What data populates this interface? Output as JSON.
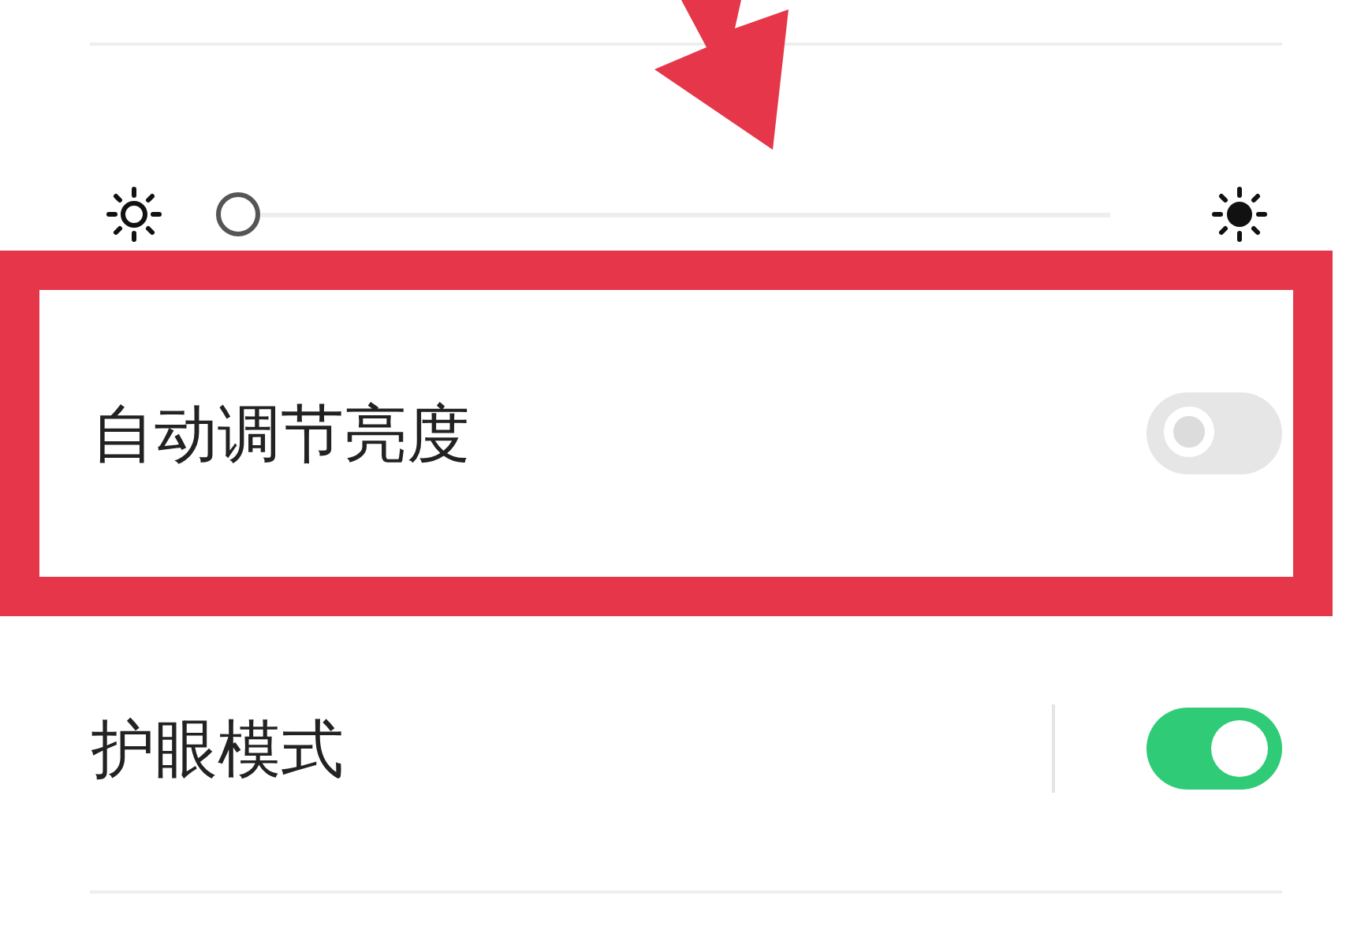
{
  "brightness": {
    "level": 0
  },
  "settings": [
    {
      "label": "自动调节亮度",
      "on": false,
      "highlighted": true,
      "separator": false
    },
    {
      "label": "护眼模式",
      "on": true,
      "highlighted": false,
      "separator": true
    }
  ]
}
